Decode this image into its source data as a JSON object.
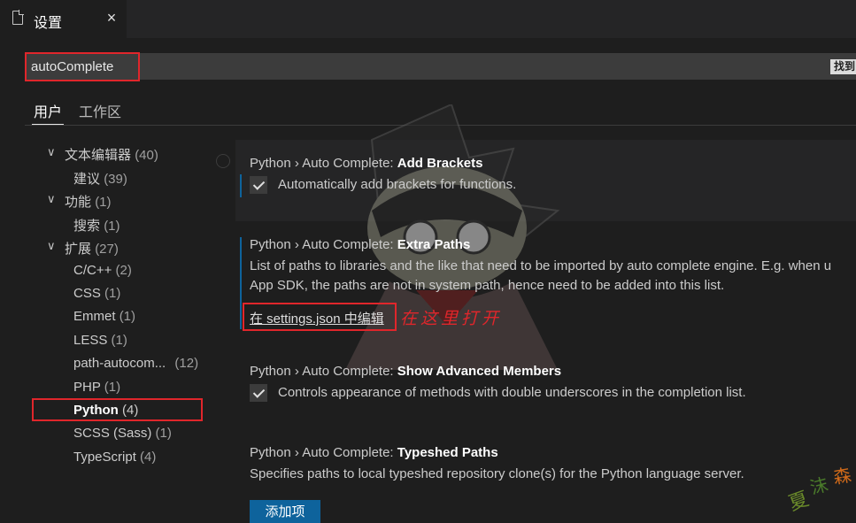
{
  "tab": {
    "title": "设置",
    "close": "×"
  },
  "search": {
    "value": "autoComplete",
    "found": "找到"
  },
  "scopes": [
    {
      "label": "用户"
    },
    {
      "label": "工作区"
    }
  ],
  "toc": [
    {
      "label": "文本编辑器",
      "count": "(40)"
    },
    {
      "label": "建议",
      "count": "(39)"
    },
    {
      "label": "功能",
      "count": "(1)"
    },
    {
      "label": "搜索",
      "count": "(1)"
    },
    {
      "label": "扩展",
      "count": "(27)"
    },
    {
      "label": "C/C++",
      "count": "(2)"
    },
    {
      "label": "CSS",
      "count": "(1)"
    },
    {
      "label": "Emmet",
      "count": "(1)"
    },
    {
      "label": "LESS",
      "count": "(1)"
    },
    {
      "label": "path-autocom...",
      "count": "(12)"
    },
    {
      "label": "PHP",
      "count": "(1)"
    },
    {
      "label": "Python",
      "count": "(4)"
    },
    {
      "label": "SCSS (Sass)",
      "count": "(1)"
    },
    {
      "label": "TypeScript",
      "count": "(4)"
    }
  ],
  "settings": {
    "add_brackets": {
      "prefix": "Python › Auto Complete: ",
      "name": "Add Brackets",
      "checkbox_label": "Automatically add brackets for functions.",
      "checked": true
    },
    "extra_paths": {
      "prefix": "Python › Auto Complete: ",
      "name": "Extra Paths",
      "desc_line1": "List of paths to libraries and the like that need to be imported by auto complete engine. E.g. when u",
      "desc_line2": "App SDK, the paths are not in system path, hence need to be added into this list.",
      "edit_link": "在 settings.json 中编辑"
    },
    "show_advanced": {
      "prefix": "Python › Auto Complete: ",
      "name": "Show Advanced Members",
      "checkbox_label": "Controls appearance of methods with double underscores in the completion list.",
      "checked": true
    },
    "typeshed_paths": {
      "prefix": "Python › Auto Complete: ",
      "name": "Typeshed Paths",
      "desc": "Specifies paths to local typeshed repository clone(s) for the Python language server.",
      "add_button": "添加项"
    }
  },
  "annotation": "在这里打开",
  "colors": {
    "accent": "#0e639c",
    "highlight_red": "#e0262b",
    "background": "#1e1e1e"
  }
}
